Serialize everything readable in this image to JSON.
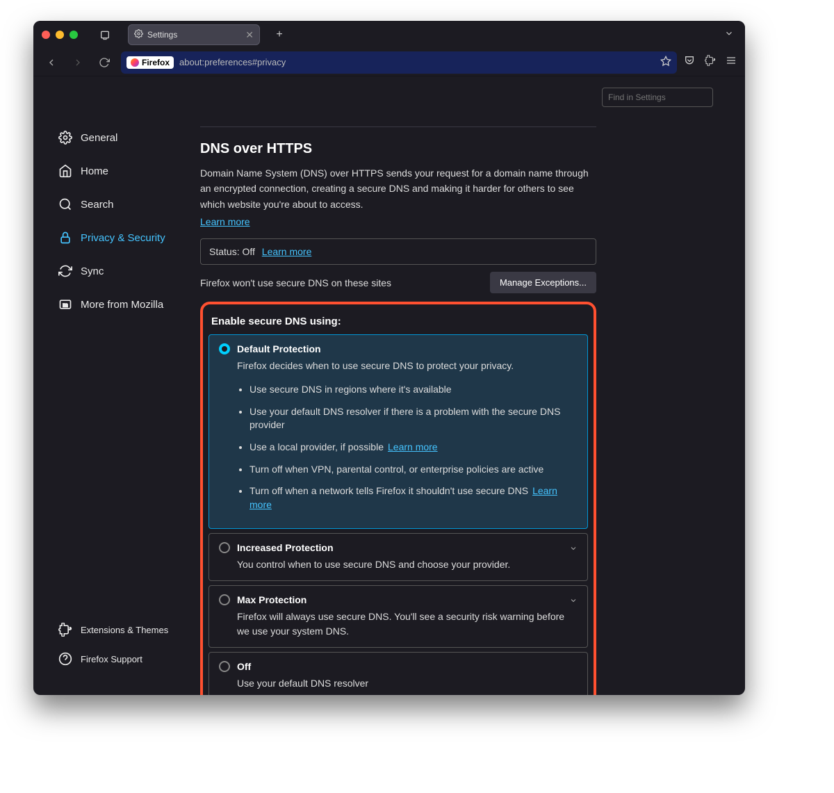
{
  "window": {
    "tab_title": "Settings",
    "browser_badge": "Firefox",
    "url": "about:preferences#privacy"
  },
  "search": {
    "placeholder": "Find in Settings"
  },
  "sidebar": {
    "items": [
      {
        "label": "General"
      },
      {
        "label": "Home"
      },
      {
        "label": "Search"
      },
      {
        "label": "Privacy & Security"
      },
      {
        "label": "Sync"
      },
      {
        "label": "More from Mozilla"
      }
    ],
    "footer": [
      {
        "label": "Extensions & Themes"
      },
      {
        "label": "Firefox Support"
      }
    ]
  },
  "main": {
    "heading": "DNS over HTTPS",
    "description": "Domain Name System (DNS) over HTTPS sends your request for a domain name through an encrypted connection, creating a secure DNS and making it harder for others to see which website you're about to access.",
    "learn_more": "Learn more",
    "status_label": "Status: Off",
    "status_learn": "Learn more",
    "exceptions_text": "Firefox won't use secure DNS on these sites",
    "exceptions_button": "Manage Exceptions...",
    "enable_heading": "Enable secure DNS using:",
    "options": [
      {
        "title": "Default Protection",
        "sub": "Firefox decides when to use secure DNS to protect your privacy.",
        "bullets": [
          "Use secure DNS in regions where it's available",
          "Use your default DNS resolver if there is a problem with the secure DNS provider",
          "Use a local provider, if possible",
          "Turn off when VPN, parental control, or enterprise policies are active",
          "Turn off when a network tells Firefox it shouldn't use secure DNS"
        ],
        "bullet_learn_2": "Learn more",
        "bullet_learn_4": "Learn more"
      },
      {
        "title": "Increased Protection",
        "sub": "You control when to use secure DNS and choose your provider."
      },
      {
        "title": "Max Protection",
        "sub": "Firefox will always use secure DNS. You'll see a security risk warning before we use your system DNS."
      },
      {
        "title": "Off",
        "sub": "Use your default DNS resolver"
      }
    ]
  }
}
